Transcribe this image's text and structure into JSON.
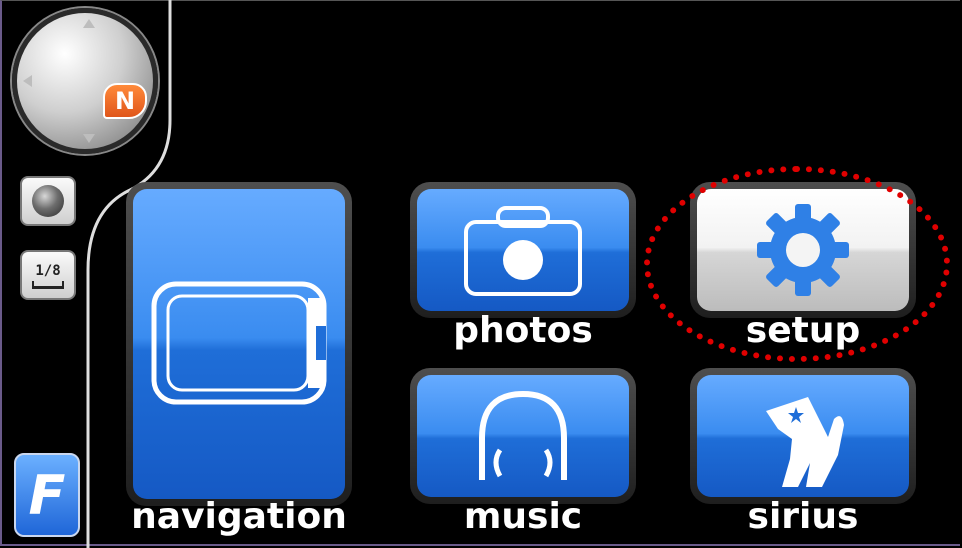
{
  "compass": {
    "heading_label": "N",
    "icon": "compass-icon"
  },
  "side_buttons": {
    "gps": {
      "icon": "gps-status-icon"
    },
    "scale": {
      "label": "1/8"
    }
  },
  "logo": {
    "text": "F",
    "icon": "ford-logo-icon"
  },
  "tiles": {
    "navigation": {
      "label": "navigation",
      "icon": "navigation-screen-icon"
    },
    "photos": {
      "label": "photos",
      "icon": "camera-icon"
    },
    "setup": {
      "label": "setup",
      "icon": "gear-icon"
    },
    "music": {
      "label": "music",
      "icon": "headphones-icon"
    },
    "sirius": {
      "label": "sirius",
      "icon": "sirius-dog-icon"
    }
  },
  "colors": {
    "tile_blue": "#3a8cf0",
    "setup_tile": "#e6e6e6",
    "highlight": "#e00000",
    "compass_badge": "#e0561b"
  }
}
